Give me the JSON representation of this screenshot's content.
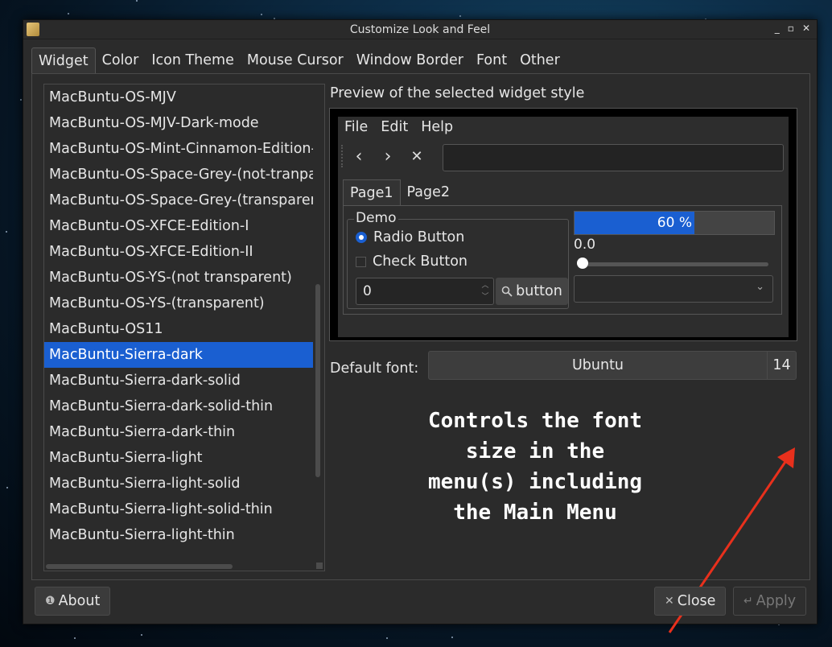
{
  "window": {
    "title": "Customize Look and Feel",
    "controls": [
      "_",
      "▫",
      "✕"
    ]
  },
  "tabs": [
    "Widget",
    "Color",
    "Icon Theme",
    "Mouse Cursor",
    "Window Border",
    "Font",
    "Other"
  ],
  "themes": [
    "MacBuntu-OS-MJV",
    "MacBuntu-OS-MJV-Dark-mode",
    "MacBuntu-OS-Mint-Cinnamon-Edition-",
    "MacBuntu-OS-Space-Grey-(not-tranpar",
    "MacBuntu-OS-Space-Grey-(transparent",
    "MacBuntu-OS-XFCE-Edition-I",
    "MacBuntu-OS-XFCE-Edition-II",
    "MacBuntu-OS-YS-(not transparent)",
    "MacBuntu-OS-YS-(transparent)",
    "MacBuntu-OS11",
    "MacBuntu-Sierra-dark",
    "MacBuntu-Sierra-dark-solid",
    "MacBuntu-Sierra-dark-solid-thin",
    "MacBuntu-Sierra-dark-thin",
    "MacBuntu-Sierra-light",
    "MacBuntu-Sierra-light-solid",
    "MacBuntu-Sierra-light-solid-thin",
    "MacBuntu-Sierra-light-thin"
  ],
  "selected_theme": "MacBuntu-Sierra-dark",
  "preview": {
    "label": "Preview of the selected widget style",
    "menu": [
      "File",
      "Edit",
      "Help"
    ],
    "toolbar": {
      "back": "‹",
      "forward": "›",
      "stop": "✕"
    },
    "tabs": [
      "Page1",
      "Page2"
    ],
    "group_label": "Demo",
    "radio_label": "Radio Button",
    "check_label": "Check Button",
    "spin_value": "0",
    "button_label": "button",
    "progress_text": "60 %",
    "progress": 0.6,
    "slider_value": "0.0",
    "slider_fraction": 0.0
  },
  "font": {
    "label": "Default font:",
    "name": "Ubuntu",
    "size": "14"
  },
  "annotation": {
    "lines": [
      "Controls the font",
      "size in the",
      "menu(s) including",
      "the Main Menu"
    ]
  },
  "buttons": {
    "about": "About",
    "close": "Close",
    "apply": "Apply"
  },
  "colors": {
    "accent": "#1a5fd1",
    "annotation_arrow": "#e8301c"
  }
}
